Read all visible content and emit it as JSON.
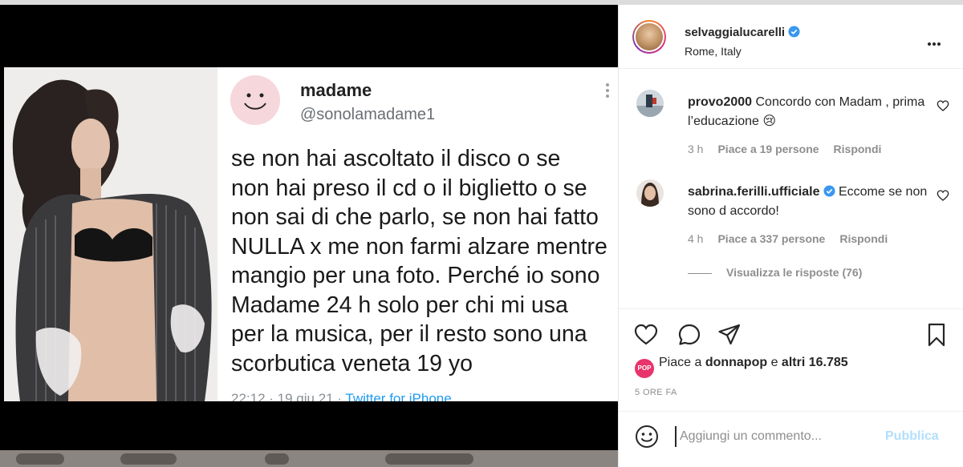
{
  "tweet": {
    "name": "madame",
    "handle": "@sonolamadame1",
    "body": "se non hai ascoltato il disco o se\nnon hai preso il cd o il biglietto o se\nnon sai di che parlo, se non hai fatto\nNULLA x me non farmi alzare mentre\nmangio per una foto. Perché io sono\nMadame 24 h solo per chi mi usa\nper la musica, per il resto sono una\nscorbutica veneta 19 yo",
    "meta_time": "22:12 · 19 giu 21 · ",
    "meta_source": "Twitter for iPhone"
  },
  "post": {
    "owner_name": "selvaggialucarelli",
    "location": "Rome, Italy"
  },
  "comments": [
    {
      "user": "provo2000",
      "text": "Concordo con Madam , prima l’educazione 😢",
      "time": "3 h",
      "likes": "Piace a 19 persone",
      "reply": "Rispondi"
    },
    {
      "user": "sabrina.ferilli.ufficiale",
      "text": "Eccome se non sono d accordo!",
      "time": "4 h",
      "likes": "Piace a 337 persone",
      "reply": "Rispondi"
    }
  ],
  "replies_toggle": "Visualizza le risposte (76)",
  "likes": {
    "badge": "POP",
    "prefix": "Piace a ",
    "user": "donnapop",
    "middle": " e ",
    "others": "altri 16.785"
  },
  "timestamp": "5 ORE FA",
  "comment_box": {
    "placeholder": "Aggiungi un commento...",
    "publish_label": "Pubblica"
  },
  "icons": {
    "options": "more-horizontal-icon",
    "like": "heart-icon",
    "comment": "comment-icon",
    "share": "paper-plane-icon",
    "save": "bookmark-icon",
    "emoji": "emoji-icon",
    "verified": "verified-badge-icon"
  },
  "colors": {
    "verified": "#3897f0",
    "link": "#1d9bf0",
    "publish_disabled": "#b2dffc",
    "pop_badge": "#e8336b"
  }
}
